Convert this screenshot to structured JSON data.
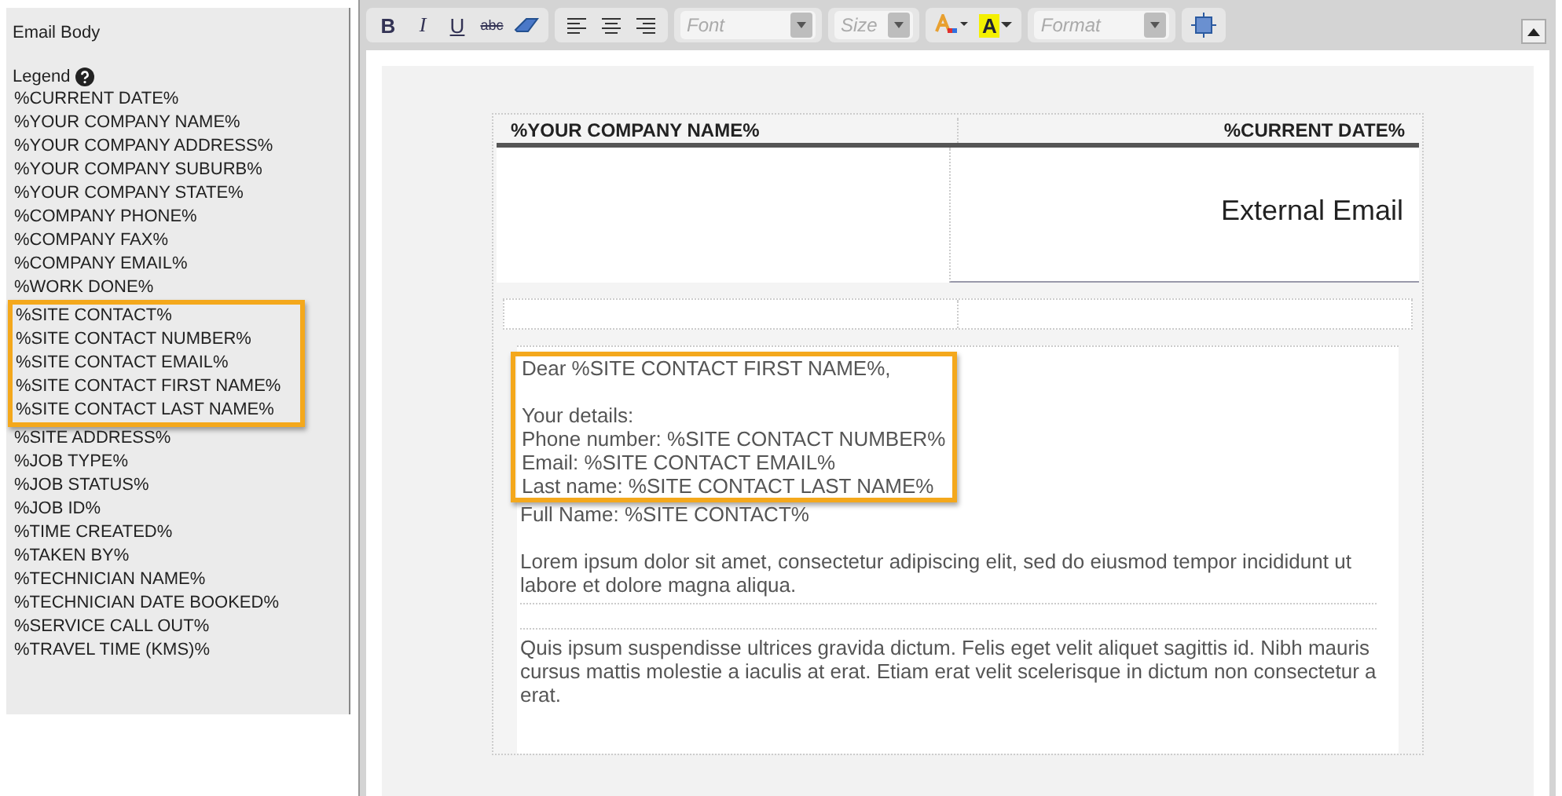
{
  "panel": {
    "title": "Email Body",
    "legend_label": "Legend",
    "items": [
      {
        "text": "%CURRENT DATE%",
        "highlighted": false
      },
      {
        "text": "%YOUR COMPANY NAME%",
        "highlighted": false
      },
      {
        "text": "%YOUR COMPANY ADDRESS%",
        "highlighted": false
      },
      {
        "text": "%YOUR COMPANY SUBURB%",
        "highlighted": false
      },
      {
        "text": "%YOUR COMPANY STATE%",
        "highlighted": false
      },
      {
        "text": "%COMPANY PHONE%",
        "highlighted": false
      },
      {
        "text": "%COMPANY FAX%",
        "highlighted": false
      },
      {
        "text": "%COMPANY EMAIL%",
        "highlighted": false
      },
      {
        "text": "%WORK DONE%",
        "highlighted": false
      },
      {
        "text": "%SITE CONTACT%",
        "highlighted": true
      },
      {
        "text": "%SITE CONTACT NUMBER%",
        "highlighted": true
      },
      {
        "text": "%SITE CONTACT EMAIL%",
        "highlighted": true
      },
      {
        "text": "%SITE CONTACT FIRST NAME%",
        "highlighted": true
      },
      {
        "text": "%SITE CONTACT LAST NAME%",
        "highlighted": true
      },
      {
        "text": "%SITE ADDRESS%",
        "highlighted": false
      },
      {
        "text": "%JOB TYPE%",
        "highlighted": false
      },
      {
        "text": "%JOB STATUS%",
        "highlighted": false
      },
      {
        "text": "%JOB ID%",
        "highlighted": false
      },
      {
        "text": "%TIME CREATED%",
        "highlighted": false
      },
      {
        "text": "%TAKEN BY%",
        "highlighted": false
      },
      {
        "text": "%TECHNICIAN NAME%",
        "highlighted": false
      },
      {
        "text": "%TECHNICIAN DATE BOOKED%",
        "highlighted": false
      },
      {
        "text": "%SERVICE CALL OUT%",
        "highlighted": false
      },
      {
        "text": "%TRAVEL TIME (KMS)%",
        "highlighted": false
      }
    ]
  },
  "toolbar": {
    "groups": [
      [
        {
          "kind": "bold",
          "label": "B"
        },
        {
          "kind": "italic",
          "label": "I"
        },
        {
          "kind": "underline",
          "label": "U"
        },
        {
          "kind": "strikethrough",
          "label": "abc"
        },
        {
          "kind": "eraser"
        }
      ],
      [
        {
          "kind": "align-left"
        },
        {
          "kind": "align-center"
        },
        {
          "kind": "align-right"
        }
      ],
      [
        {
          "kind": "select",
          "placeholder": "Font"
        }
      ],
      [
        {
          "kind": "select",
          "placeholder": "Size"
        }
      ],
      [
        {
          "kind": "text-color"
        },
        {
          "kind": "bg-color",
          "label": "A"
        }
      ],
      [
        {
          "kind": "select",
          "placeholder": "Format"
        }
      ],
      [
        {
          "kind": "maximize"
        }
      ]
    ]
  },
  "email": {
    "header_left": "%YOUR COMPANY NAME%",
    "header_right": "%CURRENT DATE%",
    "title": "External Email",
    "salutation": {
      "text": "Dear %SITE CONTACT FIRST NAME%,",
      "highlighted": true
    },
    "detail_lines": [
      {
        "text": "Your details:",
        "highlighted": true
      },
      {
        "text": "Phone number: %SITE CONTACT NUMBER%",
        "highlighted": true
      },
      {
        "text": "Email: %SITE CONTACT EMAIL%",
        "highlighted": true
      },
      {
        "text": "Last name: %SITE CONTACT LAST NAME%",
        "highlighted": true
      },
      {
        "text": "Full Name: %SITE CONTACT%",
        "highlighted": false
      }
    ],
    "paragraphs": [
      "Lorem ipsum dolor sit amet, consectetur adipiscing elit, sed do eiusmod tempor incididunt ut labore et dolore magna aliqua.",
      "Quis ipsum suspendisse ultrices gravida dictum. Felis eget velit aliquet sagittis id. Nibh mauris cursus mattis molestie a iaculis at erat. Etiam erat velit scelerisque in dictum non consectetur a erat."
    ]
  }
}
